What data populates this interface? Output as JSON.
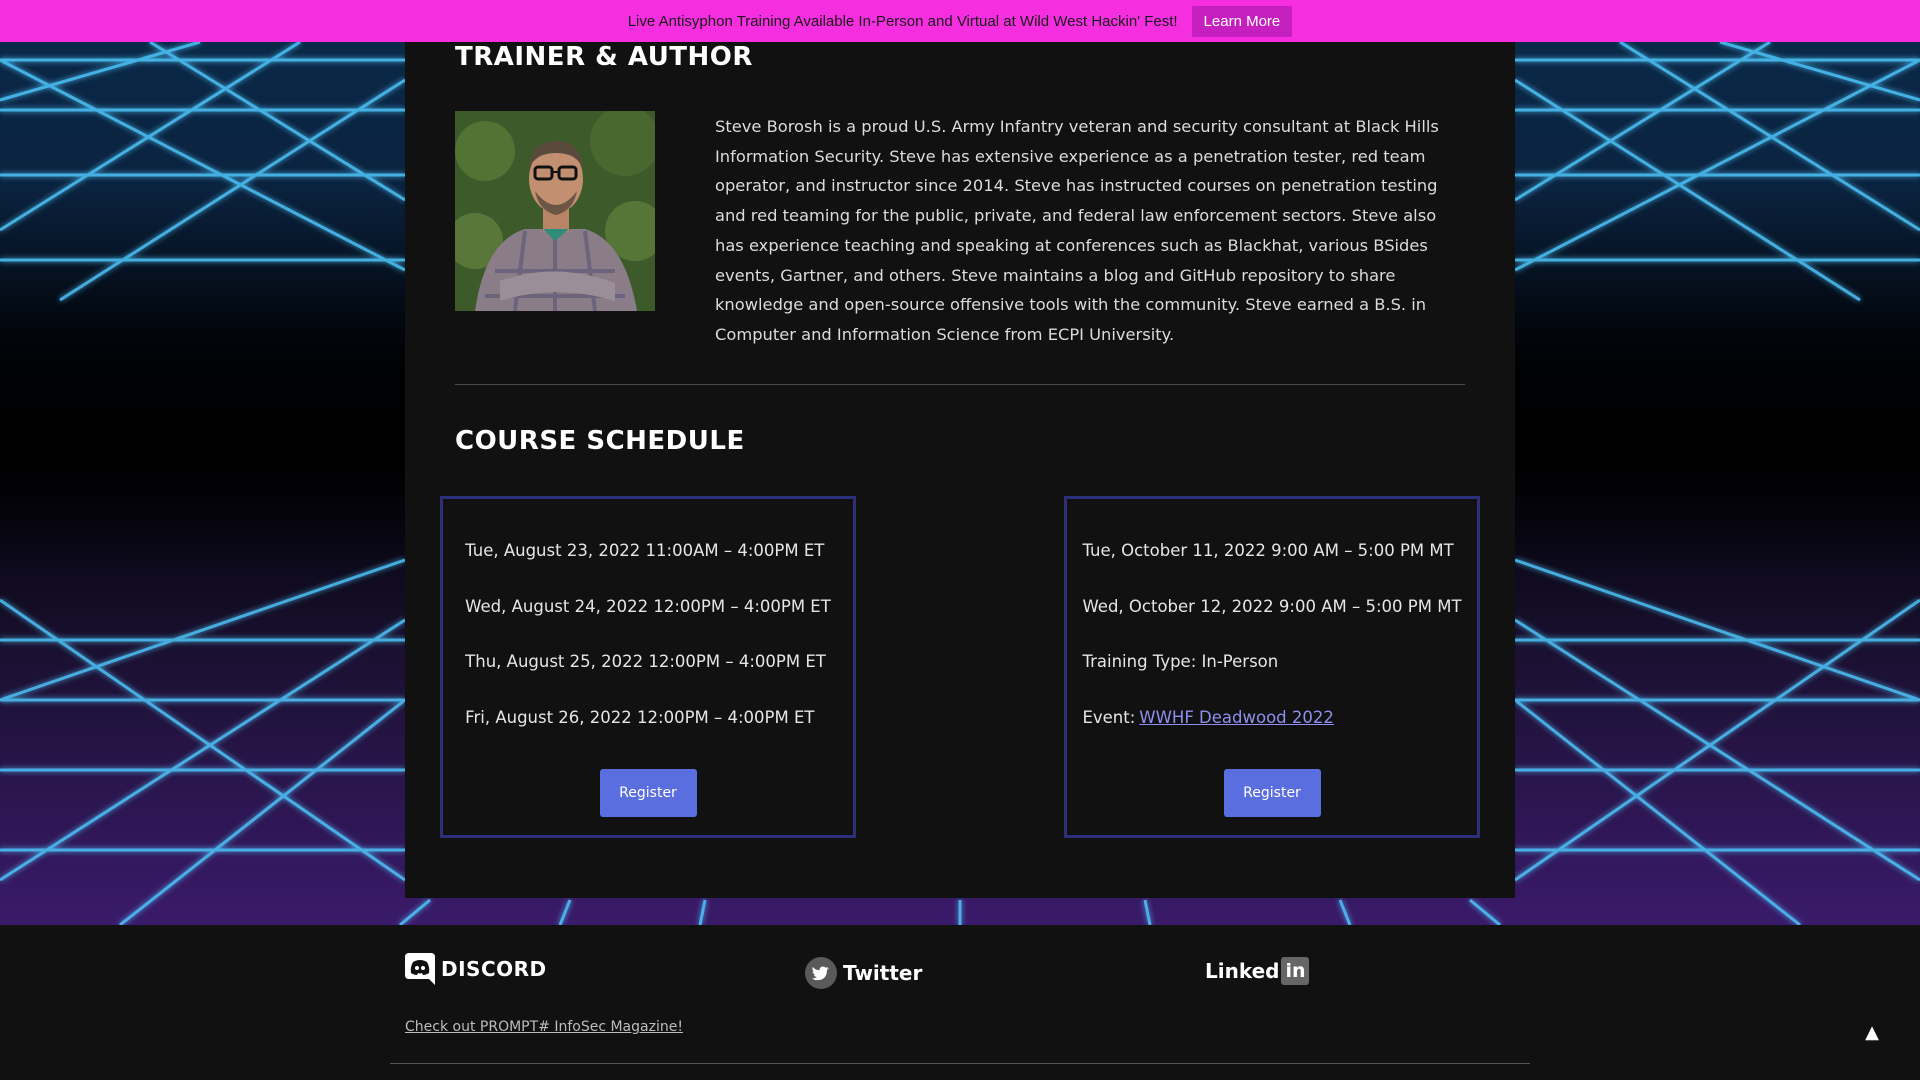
{
  "promo": {
    "text": "Live Antisyphon Training Available In-Person and Virtual at Wild West Hackin' Fest!",
    "button_label": "Learn More"
  },
  "author": {
    "title": "TRAINER & AUTHOR",
    "bio": "Steve Borosh is a proud U.S. Army Infantry veteran and security consultant at Black Hills Information Security. Steve has extensive experience as a penetration tester, red team operator, and instructor since 2014. Steve has instructed courses on penetration testing and red teaming for the public, private, and federal law enforcement sectors. Steve also has experience teaching and speaking at conferences such as Blackhat, various BSides events, Gartner, and others. Steve maintains a blog and GitHub repository to share knowledge and open-source offensive tools with the community. Steve earned a B.S. in Computer and Information Science from ECPI University."
  },
  "schedule": {
    "title": "COURSE SCHEDULE",
    "left": {
      "lines": [
        "Tue, August 23, 2022 11:00AM – 4:00PM ET",
        "Wed, August 24, 2022 12:00PM – 4:00PM ET",
        "Thu, August 25, 2022 12:00PM – 4:00PM ET",
        "Fri, August 26, 2022 12:00PM – 4:00PM ET"
      ],
      "register_label": "Register"
    },
    "right": {
      "lines": [
        "Tue, October 11, 2022 9:00 AM – 5:00 PM MT",
        "Wed, October 12, 2022 9:00 AM – 5:00 PM MT",
        "Training Type: In-Person"
      ],
      "event_prefix": "Event:",
      "event_link": "WWHF Deadwood 2022",
      "register_label": "Register"
    }
  },
  "footer": {
    "discord_label": "DISCORD",
    "twitter_label": "Twitter",
    "linkedin_label": "Linked",
    "linkedin_in": "in",
    "magazine_link": "Check out PROMPT# InfoSec Magazine!",
    "back_to_top": "▲"
  },
  "colors": {
    "promo_bg": "#f52ee0",
    "card_bg": "#111111",
    "box_border": "#2e2f7a",
    "button_bg": "#5b6ee0",
    "link": "#8f8ff0"
  },
  "icons": [
    "discord-icon",
    "twitter-icon",
    "linkedin-icon",
    "back-to-top-icon"
  ]
}
